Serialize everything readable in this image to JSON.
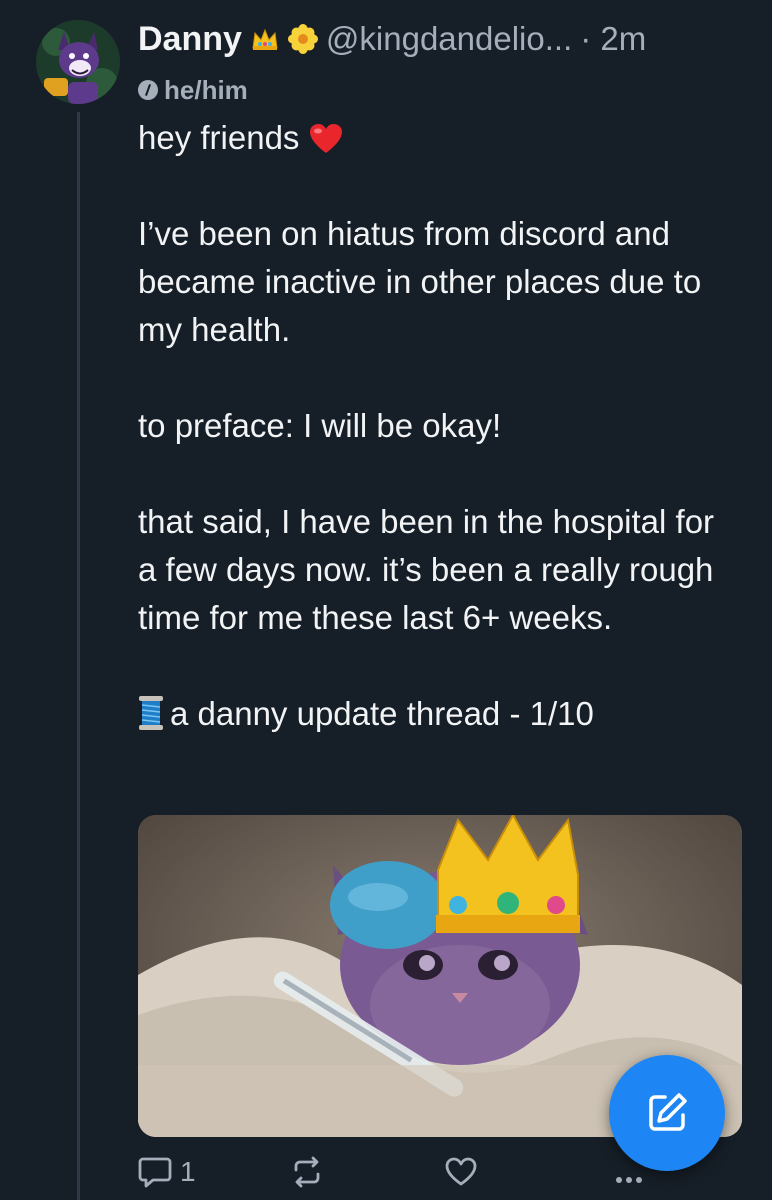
{
  "post": {
    "author": {
      "display_name": "Danny",
      "badges": [
        "crown-emoji",
        "blossom-emoji"
      ],
      "handle": "@kingdandelio...",
      "time": "· 2m",
      "pronouns": "he/him"
    },
    "text": {
      "line1": "hey friends",
      "p2": "I’ve been on hiatus from discord and became inactive in other places due to my health.",
      "p3": "to preface: I will be okay!",
      "p4": "that said, I have been in the hospital for a few days now. it’s been a really rough time for me these last 6+ weeks.",
      "p5": "a danny update thread - 1/10"
    },
    "media": {
      "subject": "kitten wrapped in blanket with ice pack, crown and thermometer"
    },
    "actions": {
      "reply_count": "1",
      "repost_count": "",
      "like_count": ""
    }
  },
  "colors": {
    "background": "#161e27",
    "text": "#f1f3f5",
    "muted": "#a4afbb",
    "accent": "#1d86f4"
  },
  "icons": {
    "reply": "reply-icon",
    "repost": "repost-icon",
    "like": "heart-icon",
    "more": "more-icon",
    "compose": "compose-icon",
    "pronoun": "pronoun-icon"
  }
}
